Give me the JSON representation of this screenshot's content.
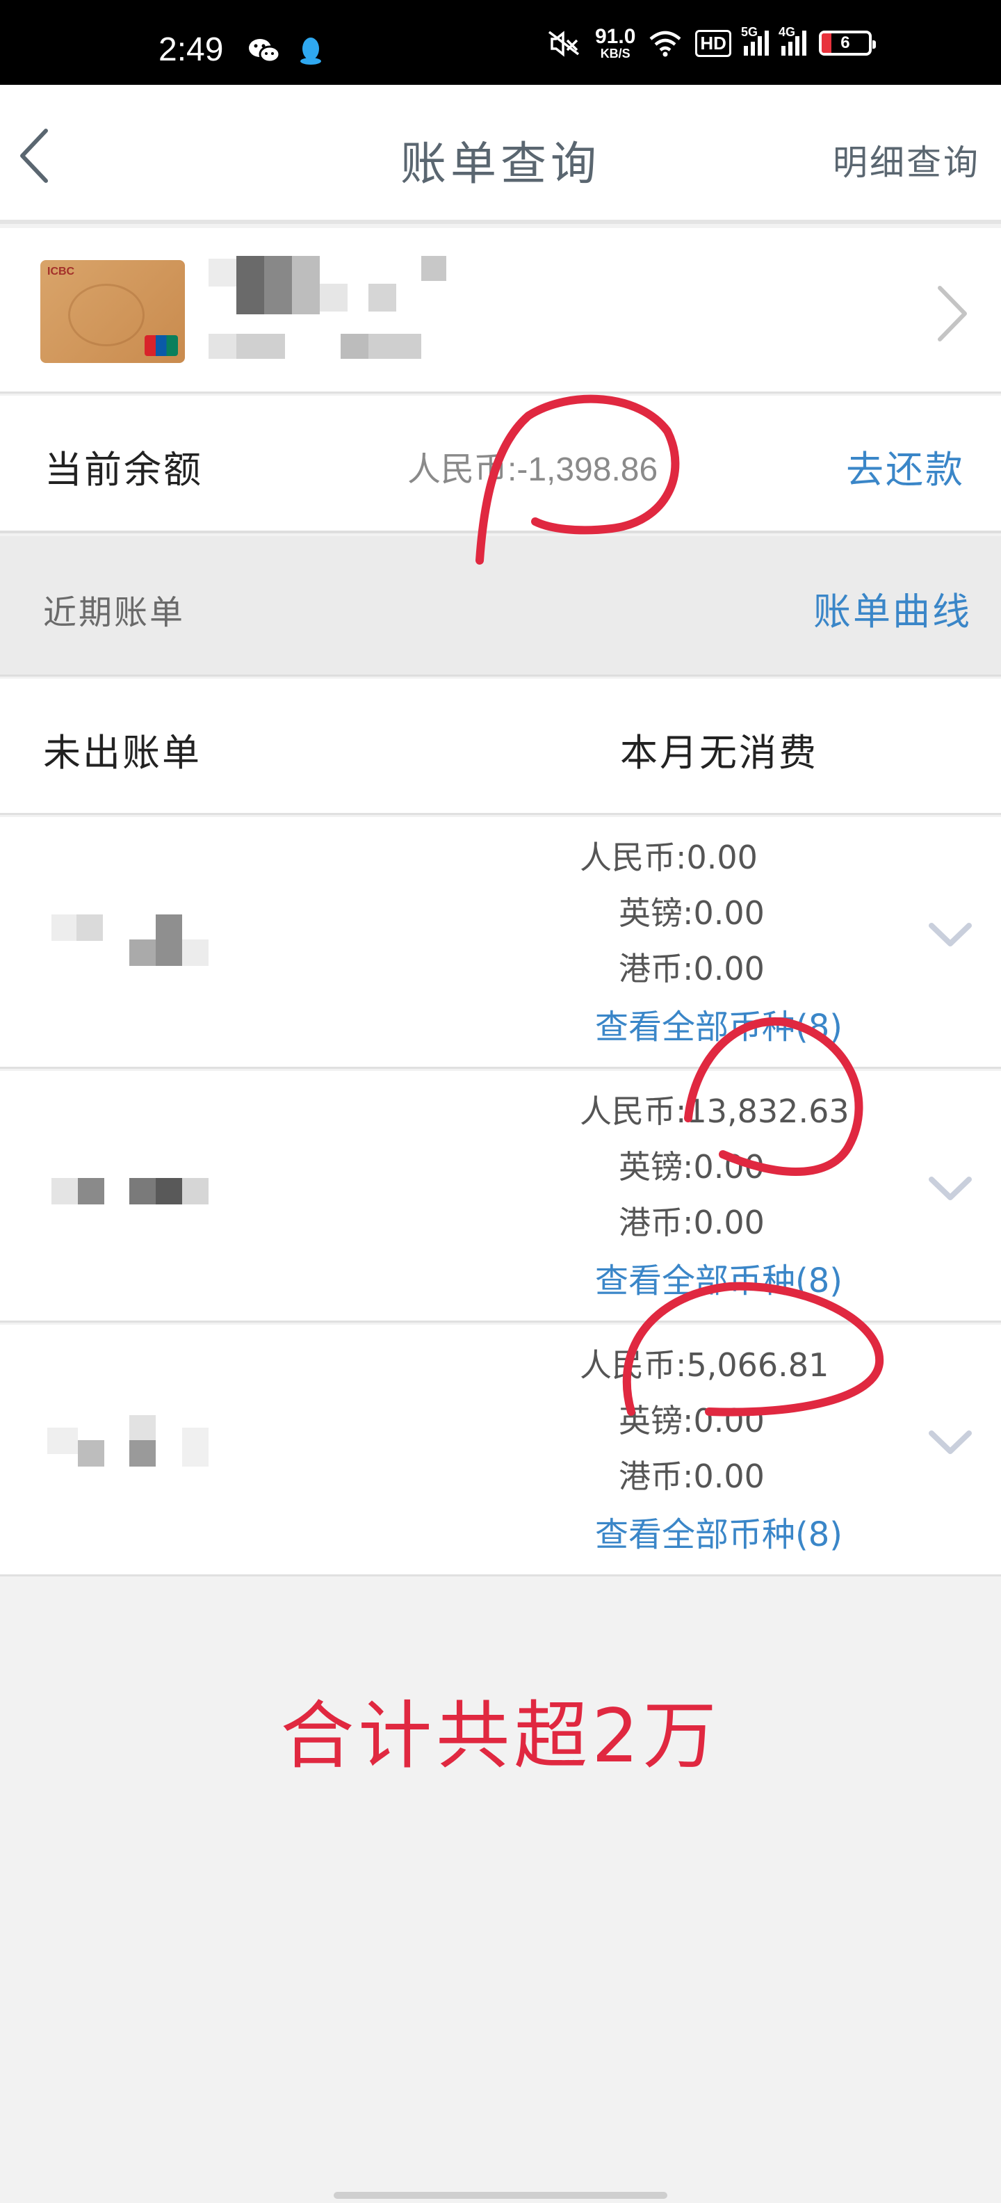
{
  "status_bar": {
    "time": "2:49",
    "speed_value": "91.0",
    "speed_unit": "KB/S",
    "hd_label": "HD",
    "sig1_label": "5G",
    "sig2_label": "4G",
    "battery_level": "6",
    "icons": [
      "wechat-icon",
      "qq-icon",
      "mute-icon",
      "wifi-icon"
    ]
  },
  "nav": {
    "title": "账单查询",
    "right_action": "明细查询"
  },
  "balance": {
    "label": "当前余额",
    "value": "人民币:-1,398.86",
    "repay_label": "去还款"
  },
  "recent": {
    "title": "近期账单",
    "curve_label": "账单曲线"
  },
  "unbilled": {
    "label": "未出账单",
    "value": "本月无消费"
  },
  "bills": [
    {
      "cny": "人民币:0.00",
      "gbp": "英镑:0.00",
      "hkd": "港币:0.00",
      "view_all": "查看全部币种(8)"
    },
    {
      "cny": "人民币:13,832.63",
      "gbp": "英镑:0.00",
      "hkd": "港币:0.00",
      "view_all": "查看全部币种(8)"
    },
    {
      "cny": "人民币:5,066.81",
      "gbp": "英镑:0.00",
      "hkd": "港币:0.00",
      "view_all": "查看全部币种(8)"
    }
  ],
  "annotation": "合计共超2万",
  "colors": {
    "accent_link": "#3a86c8",
    "annotation_red": "#e02840",
    "card_gold": "#d9a46a"
  }
}
